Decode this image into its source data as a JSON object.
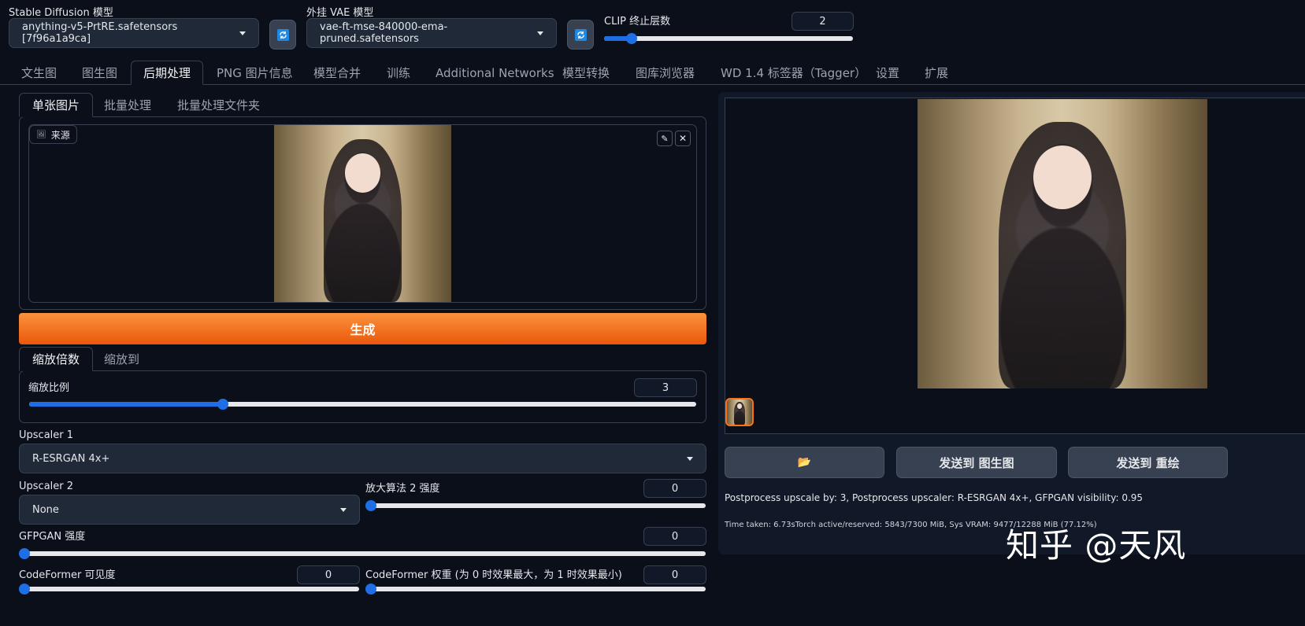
{
  "header": {
    "sd_model_label": "Stable Diffusion 模型",
    "sd_model_value": "anything-v5-PrtRE.safetensors [7f96a1a9ca]",
    "vae_label": "外挂 VAE 模型",
    "vae_value": "vae-ft-mse-840000-ema-pruned.safetensors",
    "clip_label": "CLIP 终止层数",
    "clip_value": "2"
  },
  "tabs": [
    {
      "label": "文生图"
    },
    {
      "label": "图生图"
    },
    {
      "label": "后期处理"
    },
    {
      "label": "PNG 图片信息"
    },
    {
      "label": "模型合并"
    },
    {
      "label": "训练"
    },
    {
      "label": "Additional Networks"
    },
    {
      "label": "模型转换"
    },
    {
      "label": "图库浏览器"
    },
    {
      "label": "WD 1.4 标签器（Tagger）"
    },
    {
      "label": "设置"
    },
    {
      "label": "扩展"
    }
  ],
  "active_tab": "后期处理",
  "source_tabs": [
    {
      "label": "单张图片"
    },
    {
      "label": "批量处理"
    },
    {
      "label": "批量处理文件夹"
    }
  ],
  "source_label": "来源",
  "generate_label": "生成",
  "scale_tabs": [
    {
      "label": "缩放倍数"
    },
    {
      "label": "缩放到"
    }
  ],
  "resize": {
    "label": "缩放比例",
    "value": "3",
    "fraction": 0.29
  },
  "upscaler1": {
    "label": "Upscaler 1",
    "value": "R-ESRGAN 4x+"
  },
  "upscaler2": {
    "label": "Upscaler 2",
    "value": "None"
  },
  "upscaler2_strength": {
    "label": "放大算法 2 强度",
    "value": "0",
    "fraction": 0
  },
  "gfpgan": {
    "label": "GFPGAN 强度",
    "value": "0",
    "fraction": 0
  },
  "codeformer_vis": {
    "label": "CodeFormer 可见度",
    "value": "0",
    "fraction": 0
  },
  "codeformer_weight": {
    "label": "CodeFormer 权重 (为 0 时效果最大，为 1 时效果最小)",
    "value": "0",
    "fraction": 0
  },
  "output": {
    "folder_icon": "📂",
    "send_img2img": "发送到 图生图",
    "send_inpaint": "发送到 重绘",
    "info": "Postprocess upscale by: 3, Postprocess upscaler: R-ESRGAN 4x+, GFPGAN visibility: 0.95",
    "time": "Time taken: 6.73sTorch active/reserved: 5843/7300 MiB, Sys VRAM: 9477/12288 MiB (77.12%)"
  },
  "watermark": "知乎 @天风",
  "colors": {
    "accent": "#f97316",
    "slider": "#1e6fe6",
    "background": "#0b0f19"
  }
}
